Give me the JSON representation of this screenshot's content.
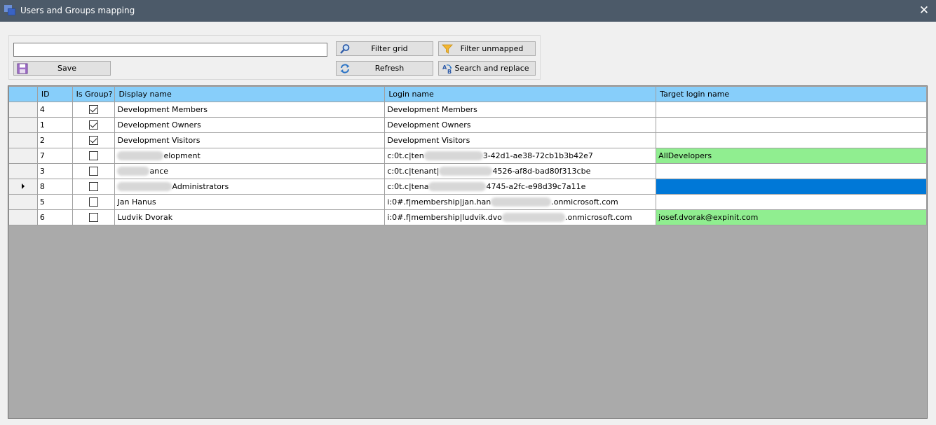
{
  "window": {
    "title": "Users and Groups mapping",
    "close_glyph": "✕"
  },
  "toolbar": {
    "filter_value": "",
    "filter_placeholder": "",
    "save_label": "Save",
    "filter_grid_label": "Filter grid",
    "refresh_label": "Refresh",
    "filter_unmapped_label": "Filter unmapped",
    "search_replace_label": "Search and replace"
  },
  "grid": {
    "columns": [
      "ID",
      "Is Group?",
      "Display name",
      "Login name",
      "Target login name"
    ],
    "rows": [
      {
        "id": "4",
        "is_group": true,
        "display_name": "Development Members",
        "login_name": "Development Members",
        "target": "",
        "state": "normal"
      },
      {
        "id": "1",
        "is_group": true,
        "display_name": "Development Owners",
        "login_name": "Development Owners",
        "target": "",
        "state": "normal"
      },
      {
        "id": "2",
        "is_group": true,
        "display_name": "Development Visitors",
        "login_name": "Development Visitors",
        "target": "",
        "state": "normal"
      },
      {
        "id": "7",
        "is_group": false,
        "display_name": "elopment",
        "login_name_prefix": "c:0t.c|ten",
        "login_name_suffix": "3-42d1-ae38-72cb1b3b42e7",
        "target": "AllDevelopers",
        "state": "mapped"
      },
      {
        "id": "3",
        "is_group": false,
        "display_name": "ance",
        "login_name_prefix": "c:0t.c|tenant|",
        "login_name_suffix": "4526-af8d-bad80f313cbe",
        "target": "",
        "state": "normal"
      },
      {
        "id": "8",
        "is_group": false,
        "display_name": "Administrators",
        "login_name_prefix": "c:0t.c|tena",
        "login_name_suffix": "4745-a2fc-e98d39c7a11e",
        "target": "",
        "state": "selected",
        "current": true
      },
      {
        "id": "5",
        "is_group": false,
        "display_name": "Jan Hanus",
        "login_name_prefix": "i:0#.f|membership|jan.han",
        "login_name_suffix": ".onmicrosoft.com",
        "target": "",
        "state": "normal"
      },
      {
        "id": "6",
        "is_group": false,
        "display_name": "Ludvik Dvorak",
        "login_name_prefix": "i:0#.f|membership|ludvik.dvo",
        "login_name_suffix": ".onmicrosoft.com",
        "target": "josef.dvorak@expinit.com",
        "state": "mapped"
      }
    ]
  },
  "icons": {
    "app": "app-windows-icon",
    "save": "floppy-disk-icon",
    "filter_grid": "magnifier-icon",
    "refresh": "refresh-arrows-icon",
    "filter_unmapped": "funnel-icon",
    "search_replace": "search-replace-ab-icon"
  },
  "colors": {
    "titlebar": "#4c5a69",
    "header": "#87cefa",
    "mapped": "#90ee90",
    "selected": "#0078d7",
    "grid_background": "#aaaaaa"
  }
}
